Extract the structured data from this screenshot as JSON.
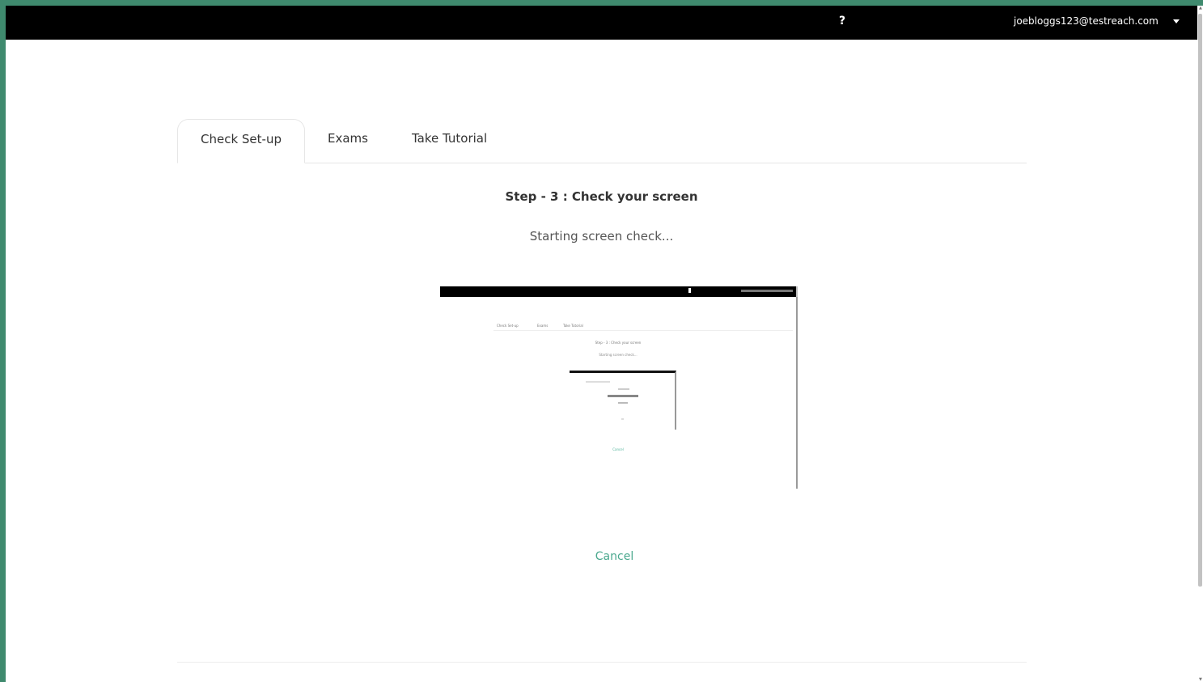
{
  "header": {
    "help_label": "?",
    "user_email": "joebloggs123@testreach.com"
  },
  "tabs": [
    {
      "label": "Check Set-up",
      "active": true
    },
    {
      "label": "Exams",
      "active": false
    },
    {
      "label": "Take Tutorial",
      "active": false
    }
  ],
  "main": {
    "step_title": "Step - 3 : Check your screen",
    "status_text": "Starting screen check...",
    "cancel_label": "Cancel"
  },
  "preview": {
    "tabs": [
      "Check Set-up",
      "Exams",
      "Take Tutorial"
    ],
    "step_title": "Step - 3 : Check your screen",
    "status_text": "Starting screen check...",
    "cancel_label": "Cancel"
  },
  "colors": {
    "accent": "#4aa88e",
    "header_bg": "#000000",
    "frame": "#3f8a6e"
  }
}
